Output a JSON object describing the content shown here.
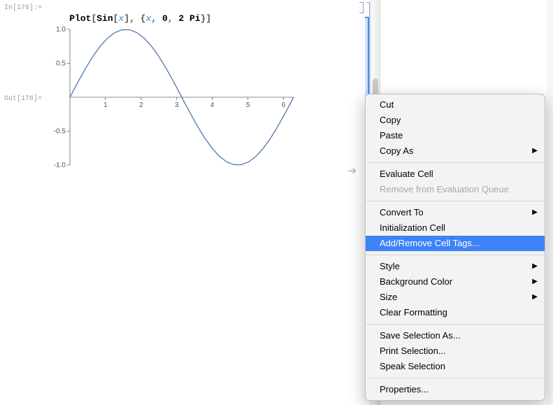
{
  "input": {
    "label": "In[176]:=",
    "code_tokens": {
      "plot": "Plot",
      "lb1": "[",
      "sin": "Sin",
      "lb2": "[",
      "x1": "x",
      "rb2": "]",
      "comma1": ", ",
      "lcb": "{",
      "x2": "x",
      "comma2": ", ",
      "zero": "0",
      "comma3": ", ",
      "two": "2",
      "pi": " Pi",
      "rcb": "}",
      "rb1": "]"
    }
  },
  "output": {
    "label": "Out[176]="
  },
  "chart_data": {
    "type": "line",
    "title": "",
    "xlabel": "",
    "ylabel": "",
    "xlim": [
      0,
      6.283185307
    ],
    "ylim": [
      -1.0,
      1.0
    ],
    "xticks": [
      1,
      2,
      3,
      4,
      5,
      6
    ],
    "yticks": [
      -1.0,
      -0.5,
      0.5,
      1.0
    ],
    "series": [
      {
        "name": "Sin[x]",
        "x": [
          0.0,
          0.2094,
          0.4189,
          0.6283,
          0.8378,
          1.0472,
          1.2566,
          1.4661,
          1.6755,
          1.885,
          2.0944,
          2.3038,
          2.5133,
          2.7227,
          2.9322,
          3.1416,
          3.351,
          3.5605,
          3.7699,
          3.9794,
          4.1888,
          4.3982,
          4.6077,
          4.8171,
          5.0265,
          5.236,
          5.4454,
          5.6549,
          5.8643,
          6.0737,
          6.2832
        ],
        "y": [
          0.0,
          0.2079,
          0.4067,
          0.5878,
          0.7431,
          0.866,
          0.9511,
          0.9945,
          0.9945,
          0.9511,
          0.866,
          0.7431,
          0.5878,
          0.4067,
          0.2079,
          0.0,
          -0.2079,
          -0.4067,
          -0.5878,
          -0.7431,
          -0.866,
          -0.9511,
          -0.9945,
          -0.9945,
          -0.9511,
          -0.866,
          -0.7431,
          -0.5878,
          -0.4067,
          -0.2079,
          0.0
        ]
      }
    ]
  },
  "menu": {
    "items": [
      {
        "label": "Cut",
        "submenu": false,
        "enabled": true,
        "highlight": false
      },
      {
        "label": "Copy",
        "submenu": false,
        "enabled": true,
        "highlight": false
      },
      {
        "label": "Paste",
        "submenu": false,
        "enabled": true,
        "highlight": false
      },
      {
        "label": "Copy As",
        "submenu": true,
        "enabled": true,
        "highlight": false
      },
      {
        "sep": true
      },
      {
        "label": "Evaluate Cell",
        "submenu": false,
        "enabled": true,
        "highlight": false
      },
      {
        "label": "Remove from Evaluation Queue",
        "submenu": false,
        "enabled": false,
        "highlight": false
      },
      {
        "sep": true
      },
      {
        "label": "Convert To",
        "submenu": true,
        "enabled": true,
        "highlight": false
      },
      {
        "label": "Initialization Cell",
        "submenu": false,
        "enabled": true,
        "highlight": false
      },
      {
        "label": "Add/Remove Cell Tags...",
        "submenu": false,
        "enabled": true,
        "highlight": true
      },
      {
        "sep": true
      },
      {
        "label": "Style",
        "submenu": true,
        "enabled": true,
        "highlight": false
      },
      {
        "label": "Background Color",
        "submenu": true,
        "enabled": true,
        "highlight": false
      },
      {
        "label": "Size",
        "submenu": true,
        "enabled": true,
        "highlight": false
      },
      {
        "label": "Clear Formatting",
        "submenu": false,
        "enabled": true,
        "highlight": false
      },
      {
        "sep": true
      },
      {
        "label": "Save Selection As...",
        "submenu": false,
        "enabled": true,
        "highlight": false
      },
      {
        "label": "Print Selection...",
        "submenu": false,
        "enabled": true,
        "highlight": false
      },
      {
        "label": "Speak Selection",
        "submenu": false,
        "enabled": true,
        "highlight": false
      },
      {
        "sep": true
      },
      {
        "label": "Properties...",
        "submenu": false,
        "enabled": true,
        "highlight": false
      }
    ]
  },
  "glyphs": {
    "submenu_arrow": "▶",
    "insertion_arrow": "➜"
  }
}
